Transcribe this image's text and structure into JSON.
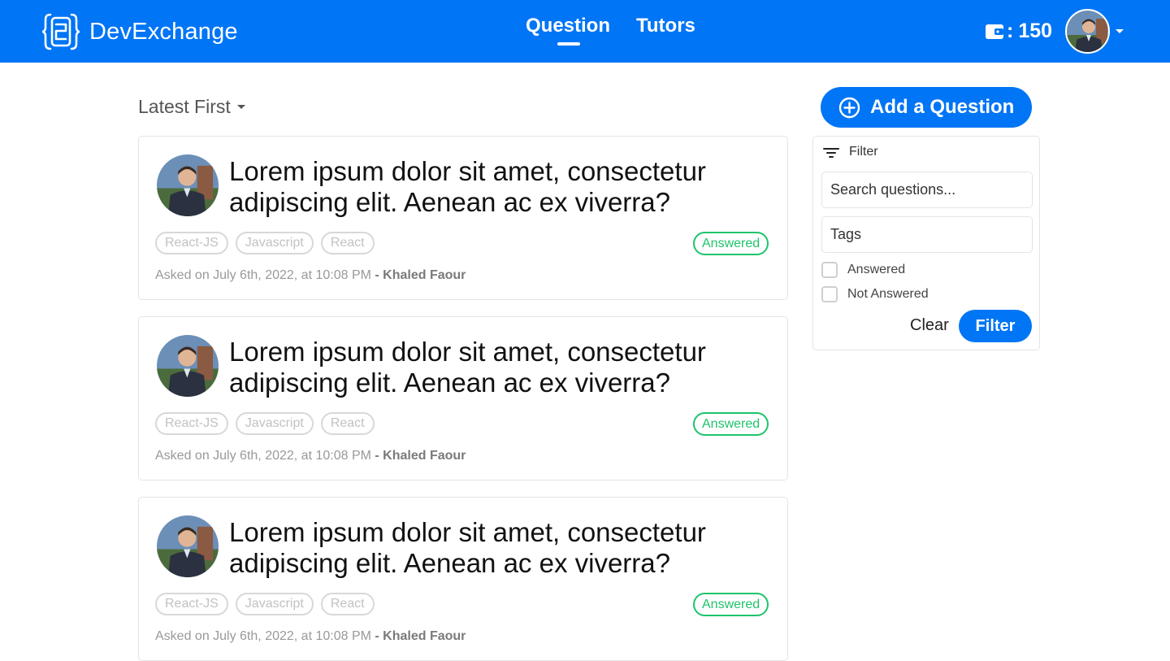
{
  "nav": {
    "brand": "DevExchange",
    "links": [
      {
        "label": "Question",
        "active": true
      },
      {
        "label": "Tutors",
        "active": false
      }
    ],
    "wallet_value": "150",
    "wallet_icon": "wallet-icon",
    "accent_color": "#0075f5"
  },
  "sort": {
    "label": "Latest First"
  },
  "questions": [
    {
      "title": "Lorem ipsum dolor sit amet, consectetur adipiscing elit. Aenean ac ex viverra?",
      "tags": [
        "React-JS",
        "Javascript",
        "React"
      ],
      "status": "Answered",
      "asked": "Asked on July 6th, 2022, at 10:08 PM",
      "separator": " - ",
      "author": "Khaled Faour"
    },
    {
      "title": "Lorem ipsum dolor sit amet, consectetur adipiscing elit. Aenean ac ex viverra?",
      "tags": [
        "React-JS",
        "Javascript",
        "React"
      ],
      "status": "Answered",
      "asked": "Asked on July 6th, 2022, at 10:08 PM",
      "separator": " - ",
      "author": "Khaled Faour"
    },
    {
      "title": "Lorem ipsum dolor sit amet, consectetur adipiscing elit. Aenean ac ex viverra?",
      "tags": [
        "React-JS",
        "Javascript",
        "React"
      ],
      "status": "Answered",
      "asked": "Asked on July 6th, 2022, at 10:08 PM",
      "separator": " - ",
      "author": "Khaled Faour"
    }
  ],
  "sidebar": {
    "add_button": "Add a Question",
    "filter": {
      "heading": "Filter",
      "search_placeholder": "Search questions...",
      "tags_placeholder": "Tags",
      "options": [
        "Answered",
        "Not Answered"
      ],
      "clear_label": "Clear",
      "filter_label": "Filter"
    }
  },
  "colors": {
    "answered": "#1ec46a"
  }
}
